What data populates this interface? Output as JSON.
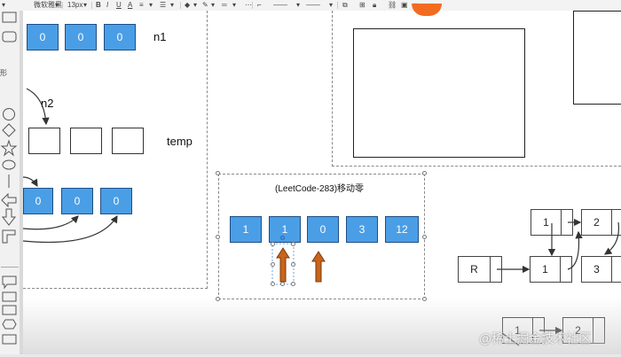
{
  "toolbar": {
    "font_name": "微软雅黑",
    "font_size": "13px",
    "bold": "B",
    "italic": "I",
    "underline": "U",
    "text_color": "A"
  },
  "leftbar": {
    "label": "形"
  },
  "canvas": {
    "top_row": {
      "values": [
        "0",
        "0",
        "0"
      ],
      "label": "n1"
    },
    "n2_label": "n2",
    "temp_label": "temp",
    "bottom_row": {
      "values": [
        "0",
        "0",
        "0"
      ]
    },
    "problem": {
      "title": "(LeetCode-283)移动零",
      "values": [
        "1",
        "1",
        "0",
        "3",
        "12"
      ]
    },
    "linked_list": {
      "top_nodes": [
        "1",
        "2"
      ],
      "bottom_nodes": [
        "R",
        "1",
        "3"
      ],
      "partial_nodes": [
        "1",
        "2"
      ]
    }
  },
  "watermark": "@稀土掘金技术社区",
  "colors": {
    "cell_fill": "#4a9ee6",
    "arrow": "#c8651b",
    "accent_orange": "#f36b21"
  }
}
